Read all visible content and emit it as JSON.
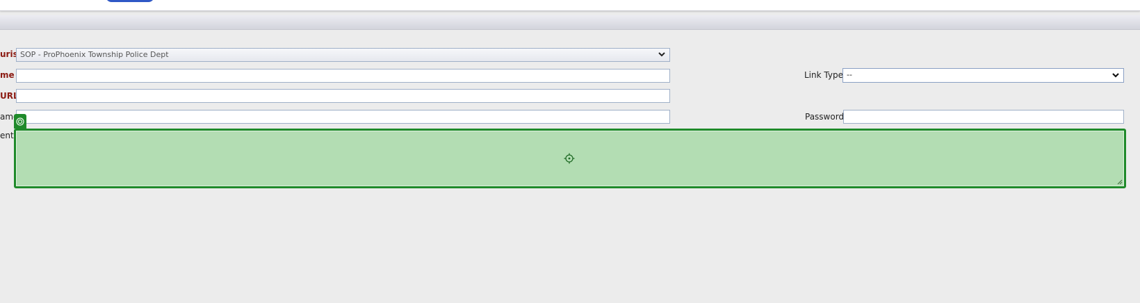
{
  "header": {},
  "form": {
    "juris_label": "uris",
    "juris_value": "SOP - ProPhoenix Township Police Dept",
    "name_label": "me",
    "name_value": "",
    "url_label": "URL",
    "url_value": "",
    "username_label": "ame",
    "username_value": "",
    "comments_label": "ents",
    "comments_value": "",
    "link_type_label": "Link Type",
    "link_type_value": "--",
    "password_label": "Password",
    "password_value": ""
  },
  "overlay": {
    "color": "#1f8a2a",
    "fill": "#b3ddb3",
    "tab_icon": "target-icon",
    "center_icon": "crosshair-icon"
  }
}
